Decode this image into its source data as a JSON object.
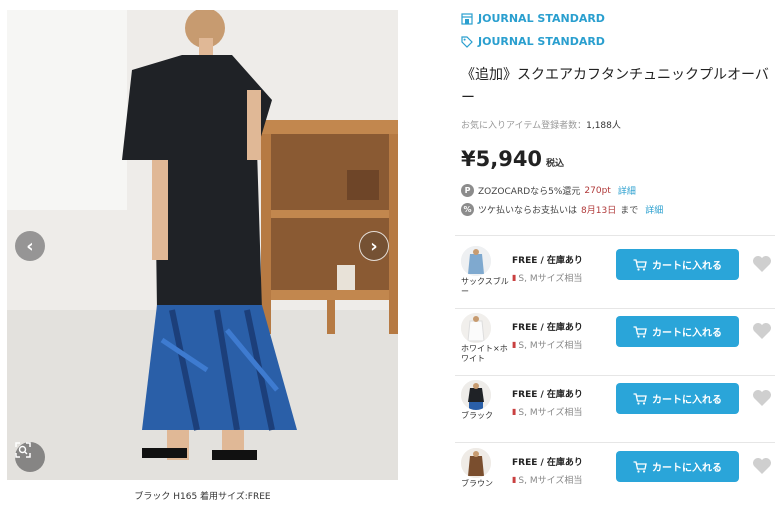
{
  "gallery": {
    "prev_icon": "chevron-left-icon",
    "next_icon": "chevron-right-icon",
    "zoom_icon": "zoom-scan-icon",
    "caption": "ブラック H165 着用サイズ:FREE"
  },
  "brand": {
    "shop_label": "JOURNAL STANDARD",
    "shop_icon": "shop-icon",
    "brand_label": "JOURNAL STANDARD",
    "brand_icon": "tag-icon",
    "color": "#2a9fcf"
  },
  "product": {
    "title": "《追加》スクエアカフタンチュニックプルオーバー",
    "favorites_label": "お気に入りアイテム登録者数：",
    "favorites_count": "1,188人",
    "price": "¥5,940",
    "tax_label": "税込"
  },
  "promos": [
    {
      "icon": "P",
      "text_a": "ZOZOCARDなら5%還元",
      "highlight": "270pt",
      "link": "詳細"
    },
    {
      "icon": "%",
      "text_a": "ツケ払いならお支払いは",
      "highlight": "8月13日",
      "text_b": "まで",
      "link": "詳細"
    }
  ],
  "variants": [
    {
      "color_name": "サックスブルー",
      "size_stock": "FREE / 在庫あり",
      "size_note": "S, Mサイズ相当",
      "cart_label": "カートに入れる"
    },
    {
      "color_name": "ホワイト×ホワイト",
      "size_stock": "FREE / 在庫あり",
      "size_note": "S, Mサイズ相当",
      "cart_label": "カートに入れる"
    },
    {
      "color_name": "ブラック",
      "size_stock": "FREE / 在庫あり",
      "size_note": "S, Mサイズ相当",
      "cart_label": "カートに入れる"
    },
    {
      "color_name": "ブラウン",
      "size_stock": "FREE / 在庫あり",
      "size_note": "S, Mサイズ相当",
      "cart_label": "カートに入れる"
    }
  ],
  "colors": {
    "cart_button": "#2aa5d9",
    "heart": "#cfcfcf",
    "link": "#2a9fcf",
    "highlight": "#b03a3a"
  }
}
